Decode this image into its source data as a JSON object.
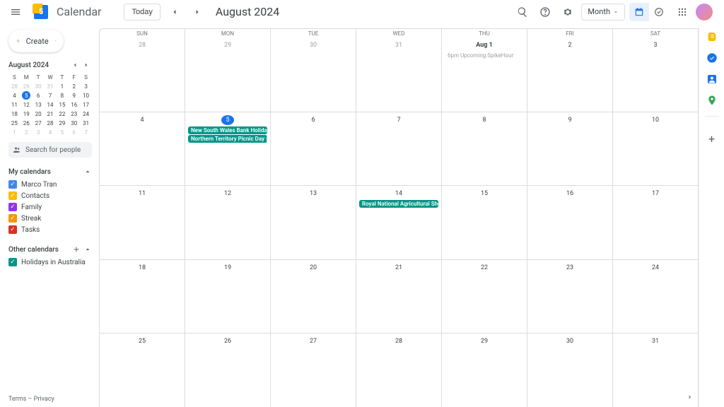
{
  "header": {
    "app_title": "Calendar",
    "logo_day": "5",
    "today_label": "Today",
    "month_title": "August 2024",
    "view_select": "Month"
  },
  "sidebar": {
    "create_label": "Create",
    "mini_month_title": "August 2024",
    "mini_dow": [
      "S",
      "M",
      "T",
      "W",
      "T",
      "F",
      "S"
    ],
    "mini_days": [
      {
        "n": "28",
        "m": true
      },
      {
        "n": "29",
        "m": true
      },
      {
        "n": "30",
        "m": true
      },
      {
        "n": "31",
        "m": true
      },
      {
        "n": "1"
      },
      {
        "n": "2"
      },
      {
        "n": "3"
      },
      {
        "n": "4"
      },
      {
        "n": "5",
        "today": true
      },
      {
        "n": "6"
      },
      {
        "n": "7"
      },
      {
        "n": "8"
      },
      {
        "n": "9"
      },
      {
        "n": "10"
      },
      {
        "n": "11"
      },
      {
        "n": "12"
      },
      {
        "n": "13"
      },
      {
        "n": "14"
      },
      {
        "n": "15"
      },
      {
        "n": "16"
      },
      {
        "n": "17"
      },
      {
        "n": "18"
      },
      {
        "n": "19"
      },
      {
        "n": "20"
      },
      {
        "n": "21"
      },
      {
        "n": "22"
      },
      {
        "n": "23"
      },
      {
        "n": "24"
      },
      {
        "n": "25"
      },
      {
        "n": "26"
      },
      {
        "n": "27"
      },
      {
        "n": "28"
      },
      {
        "n": "29"
      },
      {
        "n": "30"
      },
      {
        "n": "31"
      },
      {
        "n": "1",
        "m": true
      },
      {
        "n": "2",
        "m": true
      },
      {
        "n": "3",
        "m": true
      },
      {
        "n": "4",
        "m": true
      },
      {
        "n": "5",
        "m": true
      },
      {
        "n": "6",
        "m": true
      },
      {
        "n": "7",
        "m": true
      }
    ],
    "search_placeholder": "Search for people",
    "my_calendars_label": "My calendars",
    "other_calendars_label": "Other calendars",
    "my_calendars": [
      {
        "label": "Marco Tran",
        "color": "#4285f4"
      },
      {
        "label": "Contacts",
        "color": "#fbbc04"
      },
      {
        "label": "Family",
        "color": "#9334e6"
      },
      {
        "label": "Streak",
        "color": "#f29900"
      },
      {
        "label": "Tasks",
        "color": "#d93025"
      }
    ],
    "other_calendars": [
      {
        "label": "Holidays in Australia",
        "color": "#009688"
      }
    ],
    "terms": "Terms",
    "privacy": "Privacy"
  },
  "grid": {
    "dow": [
      "SUN",
      "MON",
      "TUE",
      "WED",
      "THU",
      "FRI",
      "SAT"
    ],
    "weeks": [
      [
        {
          "n": "28",
          "mute": true
        },
        {
          "n": "29",
          "mute": true
        },
        {
          "n": "30",
          "mute": true
        },
        {
          "n": "31",
          "mute": true
        },
        {
          "n": "Aug 1",
          "emph": true,
          "events": [
            {
              "t": "6pm Upcoming SpikeHour",
              "faint": true
            }
          ]
        },
        {
          "n": "2"
        },
        {
          "n": "3"
        }
      ],
      [
        {
          "n": "4"
        },
        {
          "n": "5",
          "today": true,
          "events": [
            {
              "t": "New South Wales Bank Holiday (New"
            },
            {
              "t": "Northern Territory Picnic Day (Northe"
            }
          ]
        },
        {
          "n": "6"
        },
        {
          "n": "7"
        },
        {
          "n": "8"
        },
        {
          "n": "9"
        },
        {
          "n": "10"
        }
      ],
      [
        {
          "n": "11"
        },
        {
          "n": "12"
        },
        {
          "n": "13"
        },
        {
          "n": "14",
          "events": [
            {
              "t": "Royal National Agricultural Show Day"
            }
          ]
        },
        {
          "n": "15"
        },
        {
          "n": "16"
        },
        {
          "n": "17"
        }
      ],
      [
        {
          "n": "18"
        },
        {
          "n": "19"
        },
        {
          "n": "20"
        },
        {
          "n": "21"
        },
        {
          "n": "22"
        },
        {
          "n": "23"
        },
        {
          "n": "24"
        }
      ],
      [
        {
          "n": "25"
        },
        {
          "n": "26"
        },
        {
          "n": "27"
        },
        {
          "n": "28"
        },
        {
          "n": "29"
        },
        {
          "n": "30"
        },
        {
          "n": "31"
        }
      ]
    ]
  },
  "rail_colors": {
    "keep": "#fbbc04",
    "tasks": "#1a73e8",
    "contacts": "#1967d2",
    "maps": "#34a853"
  }
}
